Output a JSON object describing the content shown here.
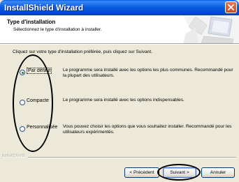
{
  "window": {
    "title": "InstallShield Wizard",
    "close_icon": "close-icon"
  },
  "header": {
    "title": "Type d'installation",
    "subtitle": "Sélectionnez le type d'installation à installer."
  },
  "instruction": "Cliquez sur votre type d'installation préférée, puis cliquez sur Suivant.",
  "options": [
    {
      "label": "Par défaut",
      "selected": true,
      "description": "Le programme sera installé avec les options les plus communes. Recommandé pour la plupart des utilisateurs."
    },
    {
      "label": "Compacte",
      "selected": false,
      "description": "Le programme sera installé avec les options indispensables."
    },
    {
      "label": "Personnalisée",
      "selected": false,
      "description": "Vous pouvez choisir les options que vous souhaitez installer. Recommandé pour les utilisateurs expérimentés."
    }
  ],
  "footer": {
    "brand": "InstallShield",
    "back_label": "< Précédent",
    "next_label": "Suivant >",
    "cancel_label": "Annuler"
  },
  "colors": {
    "titlebar": "#0a5ee0",
    "window_bg": "#ece9d8",
    "close_button": "#c74a2a"
  }
}
